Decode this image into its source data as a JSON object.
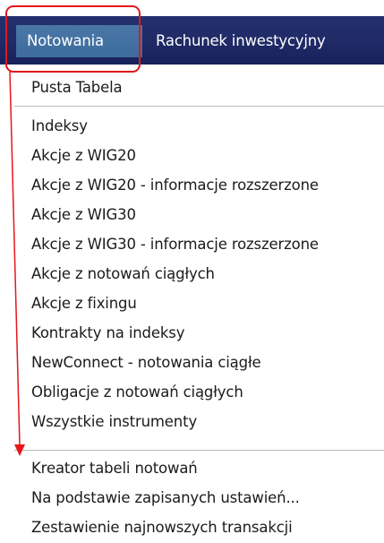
{
  "tabs": [
    {
      "label": "Notowania",
      "active": true
    },
    {
      "label": "Rachunek inwestycyjny",
      "active": false
    }
  ],
  "menu": {
    "group1": [
      "Pusta Tabela"
    ],
    "group2": [
      "Indeksy",
      "Akcje z WIG20",
      "Akcje z WIG20 - informacje rozszerzone",
      "Akcje z WIG30",
      "Akcje z WIG30 - informacje rozszerzone",
      "Akcje z notowań ciągłych",
      "Akcje z fixingu",
      "Kontrakty na indeksy",
      "NewConnect - notowania ciągłe",
      "Obligacje z notowań ciągłych",
      "Wszystkie instrumenty"
    ],
    "group3": [
      "Kreator tabeli notowań",
      "Na podstawie zapisanych ustawień...",
      "Zestawienie najnowszych transakcji"
    ]
  },
  "colors": {
    "navbar": "#1f2a66",
    "active_tab": "#4472a2",
    "annotation_red": "#e3171c",
    "separator": "#b8b8b8",
    "text": "#1b1b1b"
  }
}
